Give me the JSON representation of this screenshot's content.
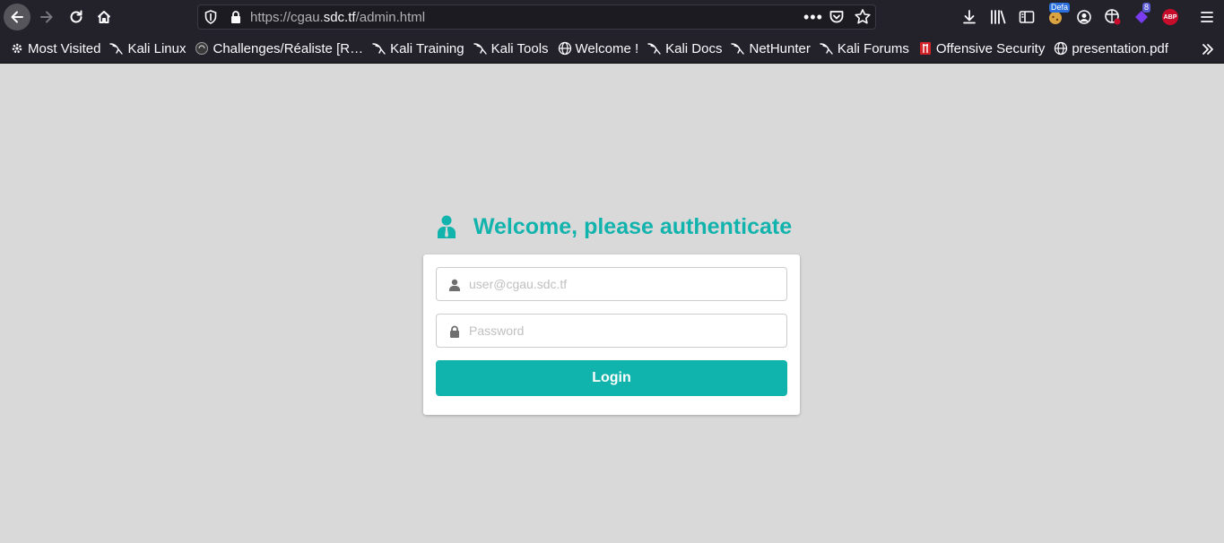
{
  "browser": {
    "url_prefix": "https://cgau.",
    "url_domain": "sdc.tf",
    "url_path": "/admin.html",
    "url_more": "•••",
    "ext_badge_default": "Defa",
    "ext_badge_count": "8",
    "abp_label": "ABP"
  },
  "bookmarks": [
    {
      "label": "Most Visited",
      "icon": "gear-icon"
    },
    {
      "label": "Kali Linux",
      "icon": "kali-dragon-icon"
    },
    {
      "label": "Challenges/Réaliste [R…",
      "icon": "rootme-icon"
    },
    {
      "label": "Kali Training",
      "icon": "kali-dragon-icon"
    },
    {
      "label": "Kali Tools",
      "icon": "kali-dragon-icon"
    },
    {
      "label": "Welcome !",
      "icon": "globe-icon"
    },
    {
      "label": "Kali Docs",
      "icon": "kali-dragon-icon"
    },
    {
      "label": "NetHunter",
      "icon": "kali-dragon-icon"
    },
    {
      "label": "Kali Forums",
      "icon": "kali-dragon-icon"
    },
    {
      "label": "Offensive Security",
      "icon": "offsec-icon"
    },
    {
      "label": "presentation.pdf",
      "icon": "globe-icon"
    }
  ],
  "login": {
    "title": "Welcome, please authenticate",
    "email_placeholder": "user@cgau.sdc.tf",
    "password_placeholder": "Password",
    "button_label": "Login"
  },
  "colors": {
    "accent": "#11b3ad",
    "page_bg": "#d9d9d9",
    "chrome_bg": "#23222b"
  }
}
